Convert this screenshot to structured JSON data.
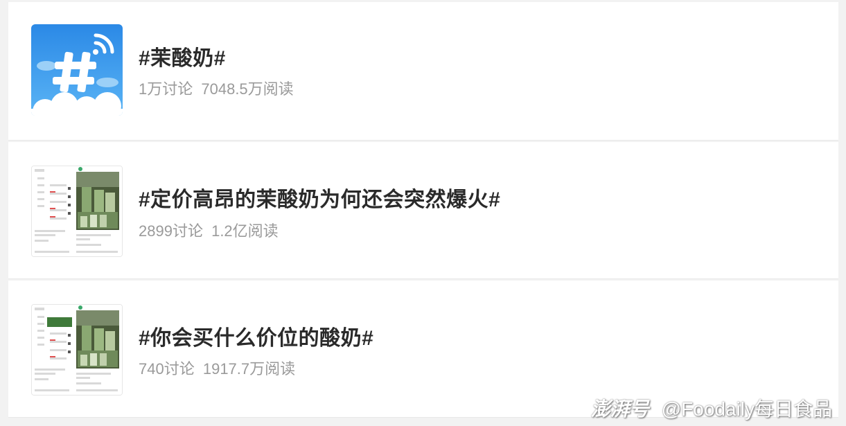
{
  "topics": [
    {
      "title": "#茉酸奶#",
      "discussions": "1万讨论",
      "reads": "7048.5万阅读",
      "thumb_icon": "hashtag-topic-icon"
    },
    {
      "title": "#定价高昂的茉酸奶为何还会突然爆火#",
      "discussions": "2899讨论",
      "reads": "1.2亿阅读",
      "thumb_icon": "post-screenshot-thumbnail"
    },
    {
      "title": "#你会买什么价位的酸奶#",
      "discussions": "740讨论",
      "reads": "1917.7万阅读",
      "thumb_icon": "post-screenshot-thumbnail"
    }
  ],
  "watermark": {
    "logo": "澎湃号",
    "account": "@Foodaily每日食品"
  },
  "colors": {
    "title": "#2a2a2a",
    "meta": "#9a9a9a",
    "icon_blue": "#2f8ee6"
  }
}
